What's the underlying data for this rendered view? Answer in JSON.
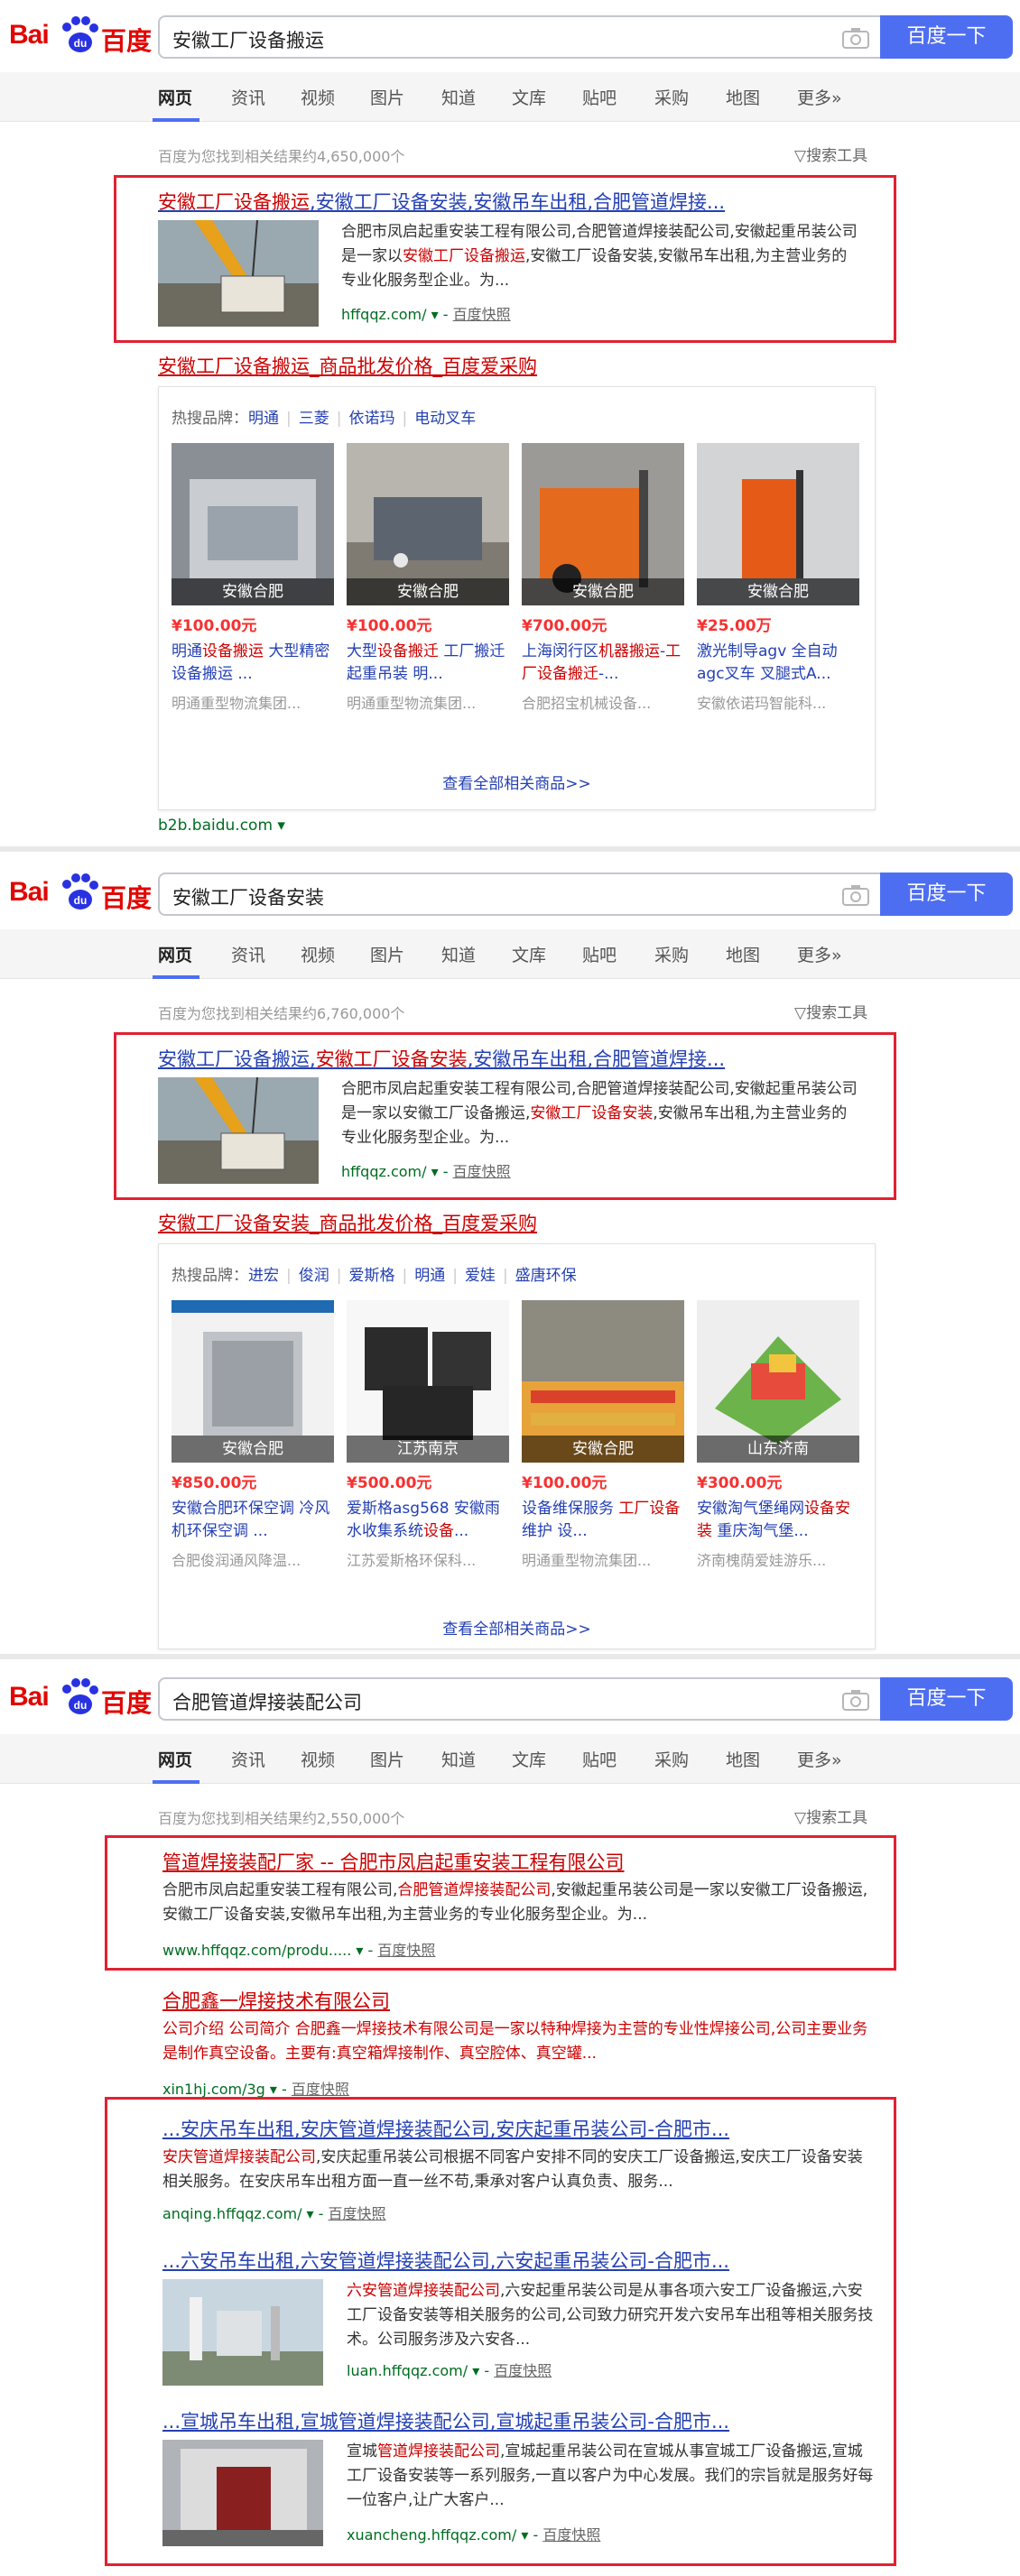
{
  "brand": {
    "logo_text": "Bai",
    "logo_cn": "百度",
    "search_button": "百度一下"
  },
  "tabs": [
    "网页",
    "资讯",
    "视频",
    "图片",
    "知道",
    "文库",
    "贴吧",
    "采购",
    "地图",
    "更多»"
  ],
  "tools_label": "搜索工具",
  "panels": [
    {
      "query": "安徽工厂设备搬运",
      "count": "百度为您找到相关结果约4,650,000个",
      "result": {
        "title_parts": [
          "安徽工厂设备搬运",
          ",安徽工厂设备安装,安徽吊车出租,合肥管道焊接..."
        ],
        "snippet_parts": [
          "合肥市凤启起重安装工程有限公司,合肥管道焊接装配公司,安徽起重吊装公司是一家以",
          "安徽工厂设备搬运",
          ",安徽工厂设备安装,安徽吊车出租,为主营业务的专业化服务型企业。为..."
        ],
        "url": "hffqqz.com/",
        "kuaizhao": "百度快照"
      },
      "b2b": {
        "title": "安徽工厂设备搬运_商品批发价格_百度爱采购",
        "hot_label": "热搜品牌：",
        "brands": [
          "明通",
          "三菱",
          "依诺玛",
          "电动叉车"
        ],
        "cards": [
          {
            "loc": "安徽合肥",
            "price": "¥100.00元",
            "name_parts": [
              "明通",
              "设备搬运",
              " 大型精密设备搬运 ..."
            ],
            "company": "明通重型物流集团..."
          },
          {
            "loc": "安徽合肥",
            "price": "¥100.00元",
            "name_parts": [
              "大型",
              "设备搬迁",
              " 工厂搬迁 起重吊装 明..."
            ],
            "company": "明通重型物流集团..."
          },
          {
            "loc": "安徽合肥",
            "price": "¥700.00元",
            "name_parts": [
              "上海闵行区",
              "机器搬运",
              "-",
              "工厂设备搬迁",
              "-..."
            ],
            "company": "合肥招宝机械设备..."
          },
          {
            "loc": "安徽合肥",
            "price": "¥25.00万",
            "name_parts": [
              "激光制导agv 全自动agc叉车 叉腿式A..."
            ],
            "company": "安徽依诺玛智能科..."
          }
        ],
        "more": "查看全部相关商品>>",
        "url": "b2b.baidu.com"
      }
    },
    {
      "query": "安徽工厂设备安装",
      "count": "百度为您找到相关结果约6,760,000个",
      "result": {
        "title_parts": [
          "安徽工厂设备搬运,",
          "安徽工厂设备安装",
          ",安徽吊车出租,合肥管道焊接..."
        ],
        "snippet_parts": [
          "合肥市凤启起重安装工程有限公司,合肥管道焊接装配公司,安徽起重吊装公司是一家以安徽工厂设备搬运,",
          "安徽工厂设备安装",
          ",安徽吊车出租,为主营业务的专业化服务型企业。为..."
        ],
        "url": "hffqqz.com/",
        "kuaizhao": "百度快照"
      },
      "b2b": {
        "title": "安徽工厂设备安装_商品批发价格_百度爱采购",
        "hot_label": "热搜品牌：",
        "brands": [
          "进宏",
          "俊润",
          "爱斯格",
          "明通",
          "爱娃",
          "盛唐环保"
        ],
        "cards": [
          {
            "loc": "安徽合肥",
            "price": "¥850.00元",
            "name_parts": [
              "安徽合肥环保空调 冷风机环保空调 ..."
            ],
            "company": "合肥俊润通风降温..."
          },
          {
            "loc": "江苏南京",
            "price": "¥500.00元",
            "name_parts": [
              "爱斯格asg568 安徽雨水收集系统",
              "设备",
              "..."
            ],
            "company": "江苏爱斯格环保科..."
          },
          {
            "loc": "安徽合肥",
            "price": "¥100.00元",
            "name_parts": [
              "设备维保服务 ",
              "工厂设备",
              "维护 设..."
            ],
            "company": "明通重型物流集团..."
          },
          {
            "loc": "山东济南",
            "price": "¥300.00元",
            "name_parts": [
              "安徽淘气堡绳网",
              "设备安装",
              " 重庆淘气堡..."
            ],
            "company": "济南槐荫爱娃游乐..."
          }
        ],
        "more": "查看全部相关商品>>"
      }
    },
    {
      "query": "合肥管道焊接装配公司",
      "count": "百度为您找到相关结果约2,550,000个",
      "results": [
        {
          "title_parts": [
            "管道焊接装配厂家 -- 合肥市凤启起重安装工程有限公司"
          ],
          "snippet_parts": [
            "合肥市凤启起重安装工程有限公司,",
            "合肥管道焊接装配公司",
            ",安徽起重吊装公司是一家以安徽工厂设备搬运,安徽工厂设备安装,安徽吊车出租,为主营业务的专业化服务型企业。为..."
          ],
          "url": "www.hffqqz.com/produ.....",
          "kuaizhao": "百度快照"
        },
        {
          "title_parts": [
            "合肥鑫一焊接技术有限公司"
          ],
          "snippet_parts": [
            "公司介绍 公司简介 合肥鑫一焊接技术有限公司是一家以特种焊接为主营的专业性焊接公司,公司主要业务是制作真空设备。主要有:真空箱焊接制作、真空腔体、真空罐..."
          ],
          "url": "xin1hj.com/3g",
          "kuaizhao": "百度快照"
        },
        {
          "title_parts": [
            "...安庆吊车出租,安庆管道焊接装配公司,安庆起重吊装公司-合肥市..."
          ],
          "snippet_parts": [
            "安庆管道焊接装配公司",
            ",安庆起重吊装公司根据不同客户安排不同的安庆工厂设备搬运,安庆工厂设备安装相关服务。在安庆吊车出租方面一直一丝不苟,秉承对客户认真负责、服务..."
          ],
          "url": "anqing.hffqqz.com/",
          "kuaizhao": "百度快照"
        },
        {
          "title_parts": [
            "...六安吊车出租,六安管道焊接装配公司,六安起重吊装公司-合肥市..."
          ],
          "snippet_parts": [
            "六安管道焊接装配公司",
            ",六安起重吊装公司是从事各项六安工厂设备搬运,六安工厂设备安装等相关服务的公司,公司致力研究开发六安吊车出租等相关服务技术。公司服务涉及六安各..."
          ],
          "url": "luan.hffqqz.com/",
          "kuaizhao": "百度快照"
        },
        {
          "title_parts": [
            "...宣城吊车出租,宣城管道焊接装配公司,宣城起重吊装公司-合肥市..."
          ],
          "snippet_parts": [
            "宣城",
            "管道焊接装配公司",
            ",宣城起重吊装公司在宣城从事宣城工厂设备搬运,宣城工厂设备安装等一系列服务,一直以客户为中心发展。我们的宗旨就是服务好每一位客户,让广大客户..."
          ],
          "url": "xuancheng.hffqqz.com/",
          "kuaizhao": "百度快照"
        }
      ]
    }
  ]
}
